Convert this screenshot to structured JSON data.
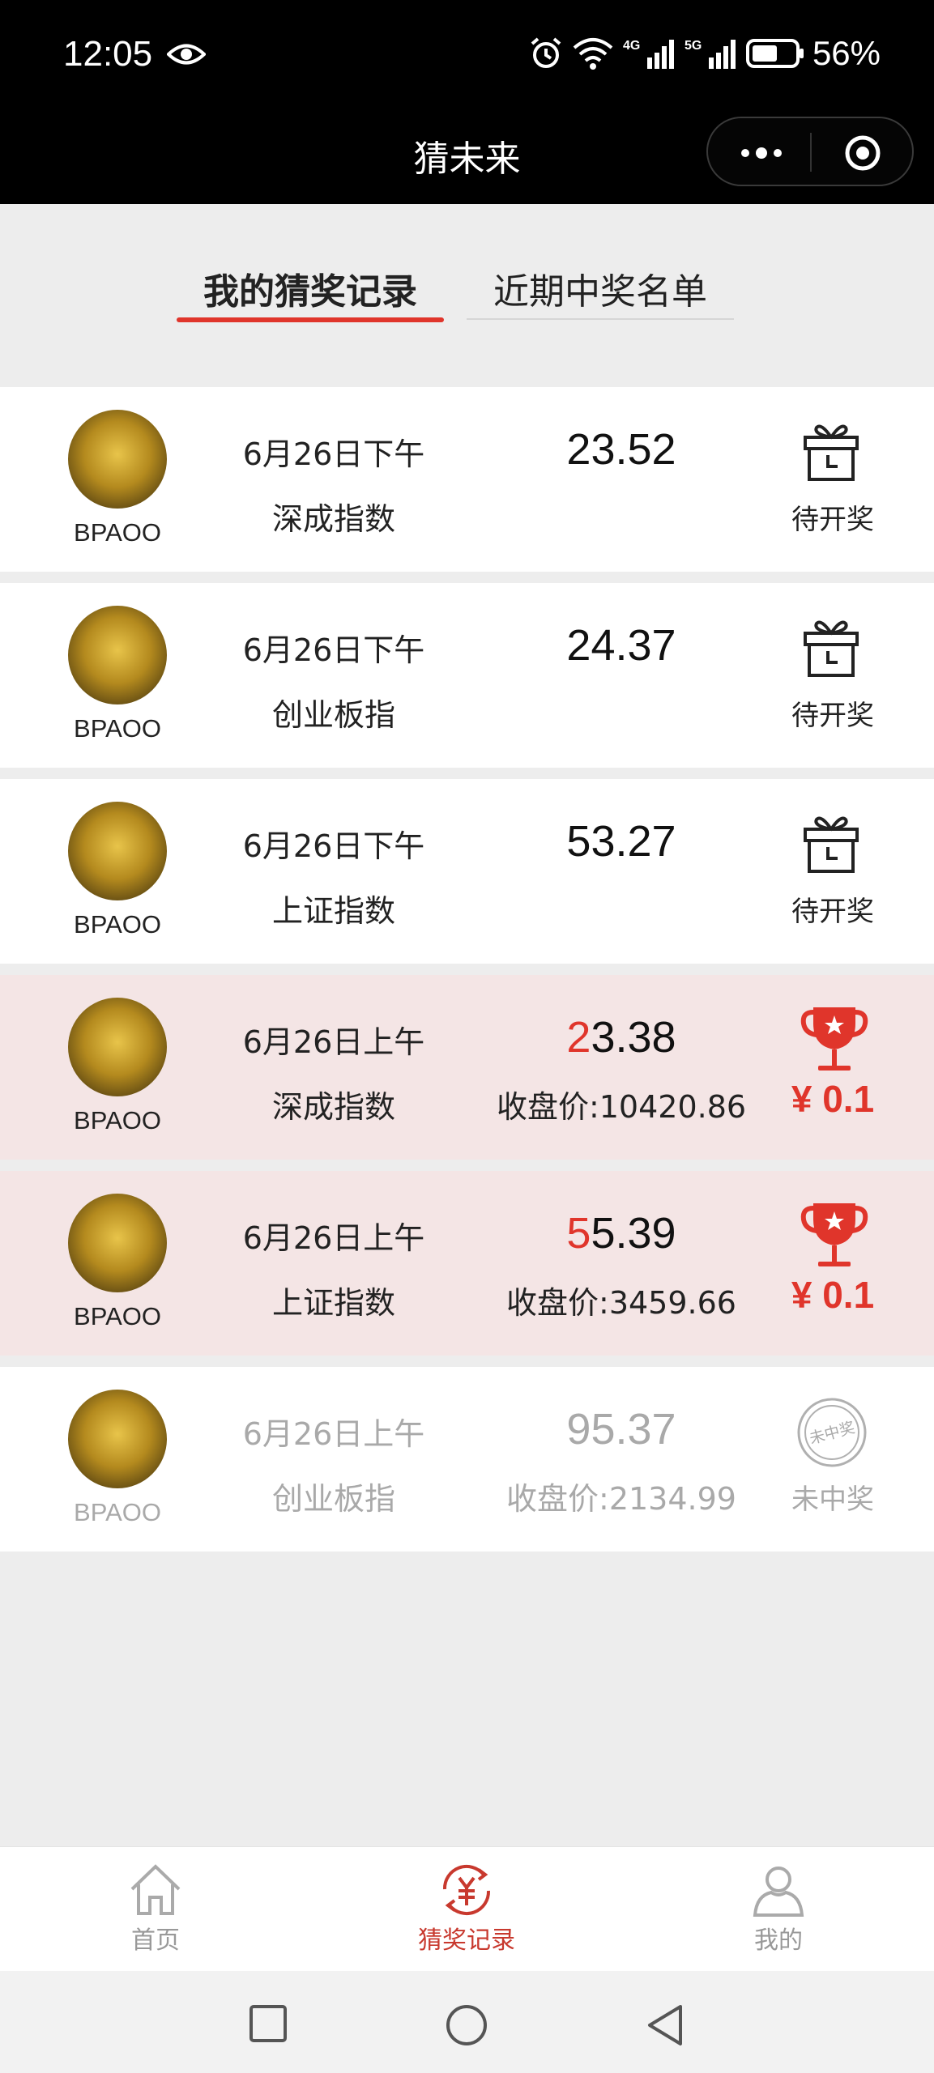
{
  "status_bar": {
    "time": "12:05",
    "battery": "56%"
  },
  "nav": {
    "title": "猜未来"
  },
  "tabs": [
    {
      "label": "我的猜奖记录",
      "active": true
    },
    {
      "label": "近期中奖名单",
      "active": false
    }
  ],
  "records": [
    {
      "user": "BPAOO",
      "date": "6月26日下午",
      "index": "深成指数",
      "guess_hit": "",
      "guess_rest": "23.52",
      "close": "",
      "status": "待开奖",
      "state": "pending"
    },
    {
      "user": "BPAOO",
      "date": "6月26日下午",
      "index": "创业板指",
      "guess_hit": "",
      "guess_rest": "24.37",
      "close": "",
      "status": "待开奖",
      "state": "pending"
    },
    {
      "user": "BPAOO",
      "date": "6月26日下午",
      "index": "上证指数",
      "guess_hit": "",
      "guess_rest": "53.27",
      "close": "",
      "status": "待开奖",
      "state": "pending"
    },
    {
      "user": "BPAOO",
      "date": "6月26日上午",
      "index": "深成指数",
      "guess_hit": "2",
      "guess_rest": "3.38",
      "close": "收盘价:10420.86",
      "status": "¥ 0.1",
      "state": "won"
    },
    {
      "user": "BPAOO",
      "date": "6月26日上午",
      "index": "上证指数",
      "guess_hit": "5",
      "guess_rest": "5.39",
      "close": "收盘价:3459.66",
      "status": "¥ 0.1",
      "state": "won"
    },
    {
      "user": "BPAOO",
      "date": "6月26日上午",
      "index": "创业板指",
      "guess_hit": "",
      "guess_rest": "95.37",
      "close": "收盘价:2134.99",
      "status": "未中奖",
      "state": "lost",
      "stamp_text": "未中奖"
    }
  ],
  "tab_bar": [
    {
      "label": "首页",
      "icon": "home-icon",
      "active": false
    },
    {
      "label": "猜奖记录",
      "icon": "guess-record-icon",
      "active": true
    },
    {
      "label": "我的",
      "icon": "user-icon",
      "active": false
    }
  ],
  "colors": {
    "accent": "#e0352b",
    "won_bg": "#f4e5e5",
    "muted": "#a9a9a9"
  }
}
